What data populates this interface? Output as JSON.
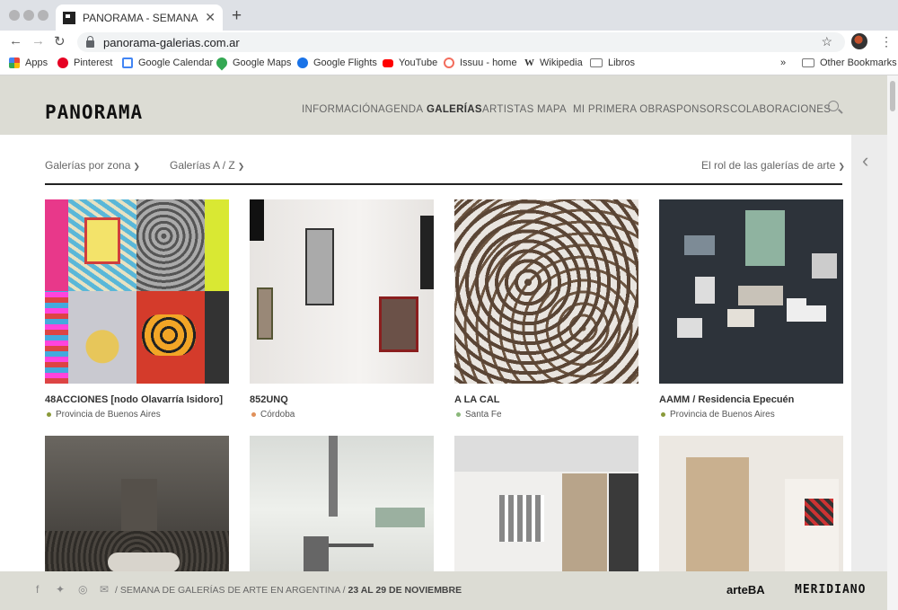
{
  "browser": {
    "tab_title": "PANORAMA - SEMANA DE GALERÍ",
    "url": "panorama-galerias.com.ar",
    "bookmarks": [
      {
        "label": "Apps",
        "color": "#e8453c"
      },
      {
        "label": "Pinterest",
        "color": "#e60023"
      },
      {
        "label": "Google Calendar",
        "color": "#4285f4"
      },
      {
        "label": "Google Maps",
        "color": "#34a853"
      },
      {
        "label": "Google Flights",
        "color": "#1a73e8"
      },
      {
        "label": "YouTube",
        "color": "#ff0000"
      },
      {
        "label": "Issuu - home",
        "color": "#f36d5d"
      },
      {
        "label": "Wikipedia",
        "color": "#444444"
      },
      {
        "label": "Libros",
        "color": "#777777"
      }
    ],
    "more": "»",
    "other_bookmarks": "Other Bookmarks"
  },
  "site": {
    "logo": "PANORAMA",
    "nav": [
      "INFORMACIÓN",
      "AGENDA",
      "GALERÍAS",
      "ARTISTAS",
      "MAPA",
      "MI PRIMERA OBRA",
      "SPONSORS",
      "COLABORACIONES"
    ],
    "active_nav": "GALERÍAS"
  },
  "filters": {
    "zona": "Galerías por zona",
    "az": "Galerías A / Z",
    "rol": "El rol de las galerías de arte"
  },
  "galleries": [
    {
      "name": "48ACCIONES [nodo Olavarría Isidoro]",
      "zone": "Provincia de Buenos Aires",
      "dot": "#8a9a3a"
    },
    {
      "name": "852UNQ",
      "zone": "Córdoba",
      "dot": "#e0905a"
    },
    {
      "name": "A LA CAL",
      "zone": "Santa Fe",
      "dot": "#8ab87a"
    },
    {
      "name": "AAMM / Residencia Epecuén",
      "zone": "Provincia de Buenos Aires",
      "dot": "#8a9a3a"
    }
  ],
  "footer": {
    "text": "/ SEMANA DE GALERÍAS DE ARTE EN ARGENTINA /",
    "dates": "23 AL 29 DE NOVIEMBRE",
    "logo1": "arteBA",
    "logo2": "MERIDIANO"
  }
}
